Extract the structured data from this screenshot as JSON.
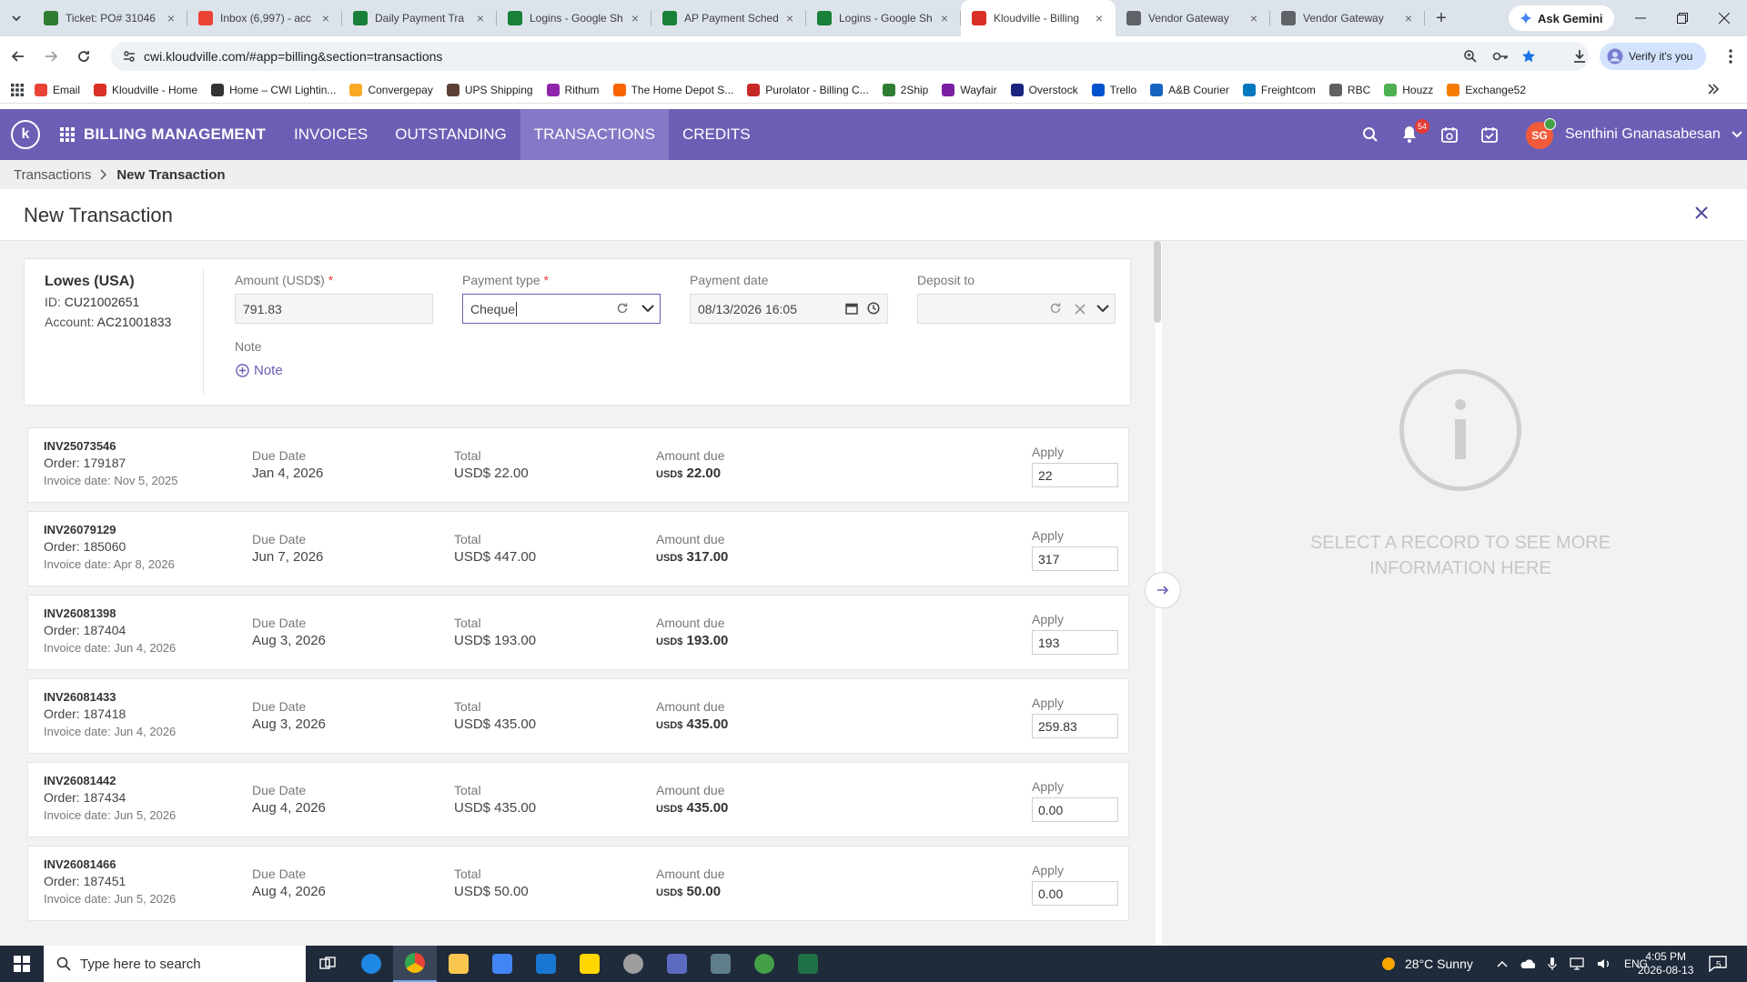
{
  "browser": {
    "tabs": [
      {
        "title": "Ticket: PO# 31046",
        "favicon_color": "#2e7d32",
        "active": false
      },
      {
        "title": "Inbox (6,997) - acc",
        "favicon_color": "#ea4335",
        "active": false
      },
      {
        "title": "Daily Payment Tra",
        "favicon_color": "#188038",
        "active": false
      },
      {
        "title": "Logins - Google Sh",
        "favicon_color": "#188038",
        "active": false
      },
      {
        "title": "AP Payment Sched",
        "favicon_color": "#188038",
        "active": false
      },
      {
        "title": "Logins - Google Sh",
        "favicon_color": "#188038",
        "active": false
      },
      {
        "title": "Kloudville - Billing",
        "favicon_color": "#d93025",
        "active": true
      },
      {
        "title": "Vendor Gateway",
        "favicon_color": "#5f6368",
        "active": false
      },
      {
        "title": "Vendor Gateway",
        "favicon_color": "#5f6368",
        "active": false
      }
    ],
    "gemini_label": "Ask Gemini",
    "url": "cwi.kloudville.com/#app=billing&section=transactions",
    "verify_label": "Verify it's you",
    "bookmarks": [
      {
        "label": "Email",
        "color": "#ea4335"
      },
      {
        "label": "Kloudville - Home",
        "color": "#d93025"
      },
      {
        "label": "Home – CWI Lightin...",
        "color": "#333333"
      },
      {
        "label": "Convergepay",
        "color": "#f9a825"
      },
      {
        "label": "UPS Shipping",
        "color": "#5d4037"
      },
      {
        "label": "Rithum",
        "color": "#8e24aa"
      },
      {
        "label": "The Home Depot S...",
        "color": "#f96302"
      },
      {
        "label": "Purolator - Billing C...",
        "color": "#c62828"
      },
      {
        "label": "2Ship",
        "color": "#2e7d32"
      },
      {
        "label": "Wayfair",
        "color": "#7b1fa2"
      },
      {
        "label": "Overstock",
        "color": "#1a237e"
      },
      {
        "label": "Trello",
        "color": "#0052cc"
      },
      {
        "label": "A&B Courier",
        "color": "#1565c0"
      },
      {
        "label": "Freightcom",
        "color": "#0277bd"
      },
      {
        "label": "RBC",
        "color": "#616161"
      },
      {
        "label": "Houzz",
        "color": "#4caf50"
      },
      {
        "label": "Exchange52",
        "color": "#f57c00"
      }
    ]
  },
  "app": {
    "name": "BILLING MANAGEMENT",
    "nav": [
      {
        "label": "INVOICES",
        "active": false
      },
      {
        "label": "OUTSTANDING",
        "active": false
      },
      {
        "label": "TRANSACTIONS",
        "active": true
      },
      {
        "label": "CREDITS",
        "active": false
      }
    ],
    "notification_count": "54",
    "user": {
      "initials": "SG",
      "name": "Senthini Gnanasabesan"
    },
    "accent_color": "#6b5fb5"
  },
  "breadcrumb": {
    "parent": "Transactions",
    "current": "New Transaction"
  },
  "page_title": "New Transaction",
  "customer": {
    "name": "Lowes (USA)",
    "id_label": "ID:",
    "id": "CU21002651",
    "account_label": "Account:",
    "account": "AC21001833"
  },
  "form": {
    "amount_label": "Amount (USD$)",
    "amount": "791.83",
    "payment_type_label": "Payment type",
    "payment_type": "Cheque",
    "payment_date_label": "Payment date",
    "payment_date": "08/13/2026 16:05",
    "deposit_label": "Deposit to",
    "deposit_value": "",
    "note_label": "Note",
    "note_link": "Note"
  },
  "invoice_labels": {
    "due_date": "Due Date",
    "total": "Total",
    "amount_due": "Amount due",
    "apply": "Apply",
    "currency": "USD$"
  },
  "invoices": [
    {
      "id": "INV25073546",
      "order": "Order: 179187",
      "invoice_date": "Invoice date: Nov 5, 2025",
      "due_date": "Jan 4, 2026",
      "total": "USD$ 22.00",
      "amount_due": "22.00",
      "apply": "22"
    },
    {
      "id": "INV26079129",
      "order": "Order: 185060",
      "invoice_date": "Invoice date: Apr 8, 2026",
      "due_date": "Jun 7, 2026",
      "total": "USD$ 447.00",
      "amount_due": "317.00",
      "apply": "317"
    },
    {
      "id": "INV26081398",
      "order": "Order: 187404",
      "invoice_date": "Invoice date: Jun 4, 2026",
      "due_date": "Aug 3, 2026",
      "total": "USD$ 193.00",
      "amount_due": "193.00",
      "apply": "193"
    },
    {
      "id": "INV26081433",
      "order": "Order: 187418",
      "invoice_date": "Invoice date: Jun 4, 2026",
      "due_date": "Aug 3, 2026",
      "total": "USD$ 435.00",
      "amount_due": "435.00",
      "apply": "259.83"
    },
    {
      "id": "INV26081442",
      "order": "Order: 187434",
      "invoice_date": "Invoice date: Jun 5, 2026",
      "due_date": "Aug 4, 2026",
      "total": "USD$ 435.00",
      "amount_due": "435.00",
      "apply": "0.00"
    },
    {
      "id": "INV26081466",
      "order": "Order: 187451",
      "invoice_date": "Invoice date: Jun 5, 2026",
      "due_date": "Aug 4, 2026",
      "total": "USD$ 50.00",
      "amount_due": "50.00",
      "apply": "0.00"
    }
  ],
  "side_panel": {
    "message": "SELECT A RECORD TO SEE MORE INFORMATION HERE"
  },
  "taskbar": {
    "search_placeholder": "Type here to search",
    "weather": "28°C  Sunny",
    "language": "ENG",
    "time": "4:05 PM",
    "date": "2026-08-13",
    "notification_count": "5"
  }
}
